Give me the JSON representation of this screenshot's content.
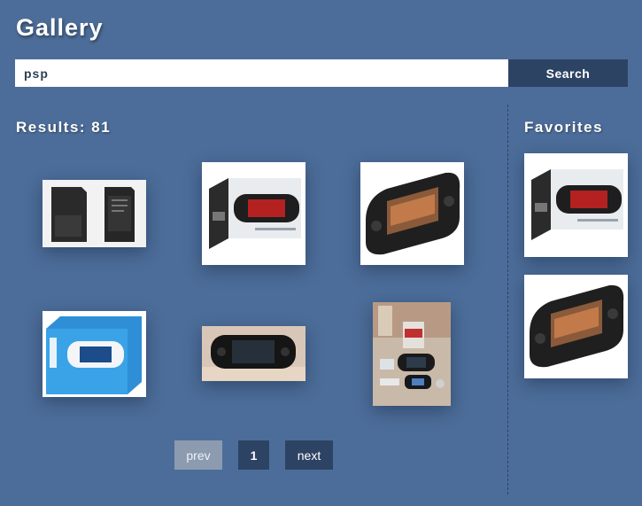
{
  "app": {
    "title": "Gallery"
  },
  "search": {
    "value": "psp",
    "button_label": "Search"
  },
  "results": {
    "heading": "Results: 81"
  },
  "favorites": {
    "heading": "Favorites"
  },
  "pagination": {
    "prev_label": "prev",
    "current_page": "1",
    "next_label": "next"
  },
  "colors": {
    "background": "#4c6d99",
    "button_dark": "#2d4364",
    "button_disabled": "#8c9bb0"
  },
  "thumbnails": [
    {
      "subject": "psp-battery"
    },
    {
      "subject": "psp-box-black"
    },
    {
      "subject": "psp-console-black"
    },
    {
      "subject": "psp-box-white"
    },
    {
      "subject": "psp-console-hand"
    },
    {
      "subject": "psp-set-photo"
    }
  ],
  "favorite_thumbnails": [
    {
      "subject": "psp-box-black"
    },
    {
      "subject": "psp-console-black"
    }
  ]
}
